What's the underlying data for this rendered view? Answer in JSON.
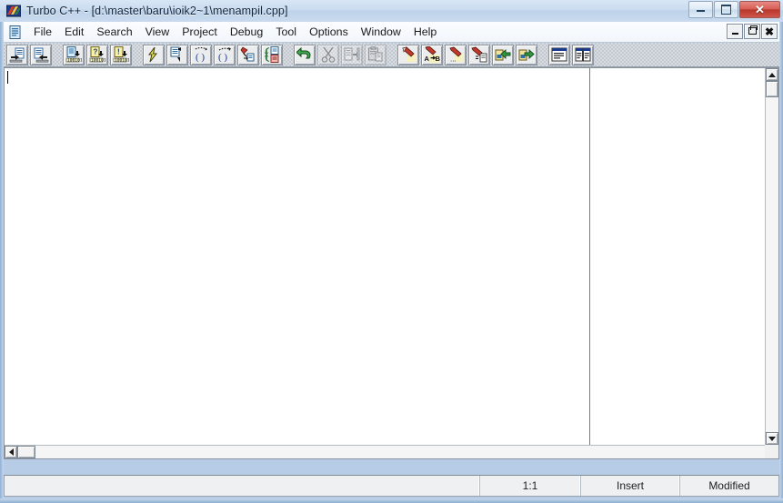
{
  "window": {
    "title": "Turbo C++ - [d:\\master\\baru\\ioik2~1\\menampil.cpp]",
    "app_name": "Turbo C++",
    "document_path": "d:\\master\\baru\\ioik2~1\\menampil.cpp",
    "icon": "turbo-cpp-icon",
    "controls": {
      "minimize": "minimize-icon",
      "maximize": "maximize-icon",
      "close": "close-icon"
    },
    "accent_close": "#c0392b",
    "accent_titlebar": "#cbdcf0"
  },
  "menubar": {
    "document_icon": "document-icon",
    "items": [
      {
        "label": "File",
        "name": "menu-file"
      },
      {
        "label": "Edit",
        "name": "menu-edit"
      },
      {
        "label": "Search",
        "name": "menu-search"
      },
      {
        "label": "View",
        "name": "menu-view"
      },
      {
        "label": "Project",
        "name": "menu-project"
      },
      {
        "label": "Debug",
        "name": "menu-debug"
      },
      {
        "label": "Tool",
        "name": "menu-tool"
      },
      {
        "label": "Options",
        "name": "menu-options"
      },
      {
        "label": "Window",
        "name": "menu-window"
      },
      {
        "label": "Help",
        "name": "menu-help"
      }
    ],
    "mdi_controls": {
      "minimize": "mdi-minimize-icon",
      "restore": "mdi-restore-icon",
      "close": "mdi-close-icon"
    }
  },
  "toolbar": {
    "groups": [
      {
        "name": "file-group",
        "buttons": [
          {
            "icon": "open-file-icon",
            "tooltip": "Open",
            "disabled": false
          },
          {
            "icon": "save-file-icon",
            "tooltip": "Save",
            "disabled": false
          }
        ]
      },
      {
        "name": "project-group",
        "buttons": [
          {
            "icon": "compile-unit-icon",
            "tooltip": "Compile",
            "disabled": false
          },
          {
            "icon": "help-target-icon",
            "tooltip": "Make",
            "disabled": false
          },
          {
            "icon": "build-target-icon",
            "tooltip": "Build",
            "disabled": false
          }
        ]
      },
      {
        "name": "run-group",
        "buttons": [
          {
            "icon": "run-lightning-icon",
            "tooltip": "Run",
            "disabled": false
          },
          {
            "icon": "step-over-icon",
            "tooltip": "Step over",
            "disabled": false
          },
          {
            "icon": "trace-into-icon",
            "tooltip": "Trace into",
            "disabled": false
          },
          {
            "icon": "step-out-icon",
            "tooltip": "Step out",
            "disabled": false
          },
          {
            "icon": "goto-definition-icon",
            "tooltip": "Goto",
            "disabled": false
          },
          {
            "icon": "swap-source-icon",
            "tooltip": "Swap source",
            "disabled": false
          }
        ]
      },
      {
        "name": "edit-group",
        "buttons": [
          {
            "icon": "undo-icon",
            "tooltip": "Undo",
            "disabled": false
          },
          {
            "icon": "cut-icon",
            "tooltip": "Cut",
            "disabled": true
          },
          {
            "icon": "copy-icon",
            "tooltip": "Copy",
            "disabled": true
          },
          {
            "icon": "paste-icon",
            "tooltip": "Paste",
            "disabled": true
          }
        ]
      },
      {
        "name": "search-group",
        "buttons": [
          {
            "icon": "find-icon",
            "tooltip": "Find",
            "disabled": false
          },
          {
            "icon": "replace-icon",
            "tooltip": "Replace",
            "disabled": false,
            "label": "A→B"
          },
          {
            "icon": "find-options-icon",
            "tooltip": "Search options",
            "disabled": false
          },
          {
            "icon": "find-in-files-icon",
            "tooltip": "Find in files",
            "disabled": false
          },
          {
            "icon": "previous-bookmark-icon",
            "tooltip": "Previous",
            "disabled": false
          },
          {
            "icon": "next-bookmark-icon",
            "tooltip": "Next",
            "disabled": false
          }
        ]
      },
      {
        "name": "window-group",
        "buttons": [
          {
            "icon": "window-list-icon",
            "tooltip": "Window list",
            "disabled": false
          },
          {
            "icon": "tile-windows-icon",
            "tooltip": "Tile windows",
            "disabled": false
          }
        ]
      }
    ]
  },
  "editor": {
    "content": "",
    "margin_column_x": 643,
    "background": "#ffffff",
    "vscroll": {
      "up_icon": "scroll-up-icon",
      "down_icon": "scroll-down-icon",
      "thumb": "vertical-scroll-thumb"
    },
    "hscroll": {
      "left_icon": "scroll-left-icon",
      "right_icon": "scroll-right-icon",
      "thumb": "horizontal-scroll-thumb"
    }
  },
  "statusbar": {
    "message": "",
    "cursor_position": "1:1",
    "insert_mode": "Insert",
    "modified_state": "Modified"
  }
}
